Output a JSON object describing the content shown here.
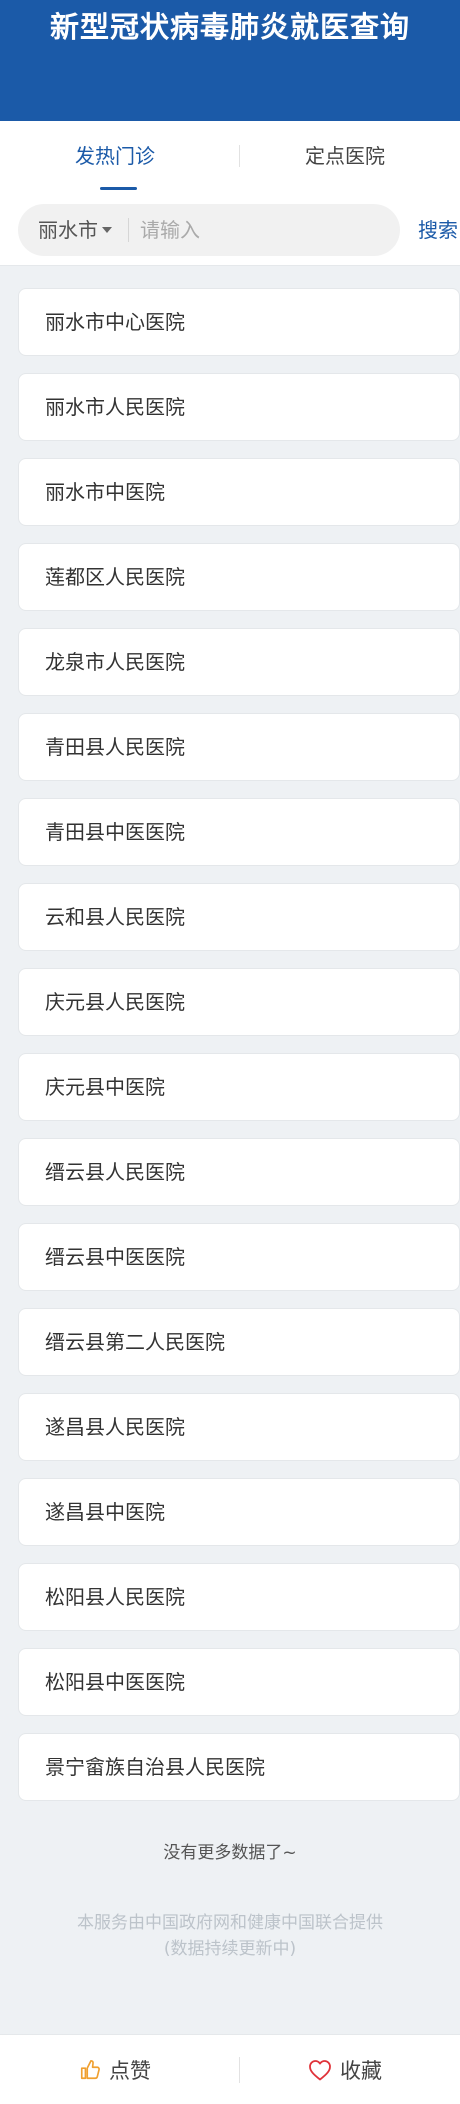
{
  "header": {
    "title": "新型冠状病毒肺炎就医查询"
  },
  "tabs": [
    {
      "label": "发热门诊",
      "active": true
    },
    {
      "label": "定点医院",
      "active": false
    }
  ],
  "search": {
    "city": "丽水市",
    "placeholder": "请输入",
    "value": "",
    "button_label": "搜索"
  },
  "hospitals": [
    "丽水市中心医院",
    "丽水市人民医院",
    "丽水市中医院",
    "莲都区人民医院",
    "龙泉市人民医院",
    "青田县人民医院",
    "青田县中医医院",
    "云和县人民医院",
    "庆元县人民医院",
    "庆元县中医院",
    "缙云县人民医院",
    "缙云县中医医院",
    "缙云县第二人民医院",
    "遂昌县人民医院",
    "遂昌县中医院",
    "松阳县人民医院",
    "松阳县中医医院",
    "景宁畲族自治县人民医院"
  ],
  "list_end": "没有更多数据了~",
  "footer": {
    "line1": "本服务由中国政府网和健康中国联合提供",
    "line2": "(数据持续更新中)"
  },
  "bottom_bar": {
    "like_label": "点赞",
    "favorite_label": "收藏"
  },
  "colors": {
    "brand": "#1b5aa8",
    "heart": "#e0333a",
    "thumb": "#f0a030"
  }
}
